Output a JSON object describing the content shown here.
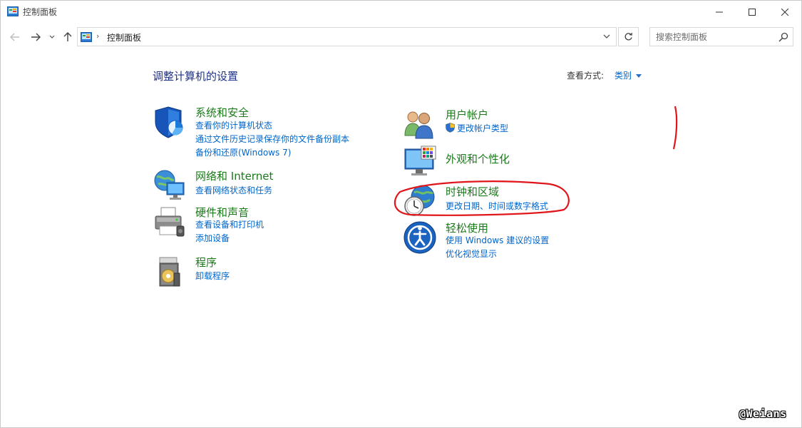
{
  "window": {
    "title": "控制面板"
  },
  "address": {
    "crumb": "控制面板"
  },
  "search": {
    "placeholder": "搜索控制面板"
  },
  "content": {
    "page_title": "调整计算机的设置",
    "view_by_label": "查看方式:",
    "view_by_value": "类别"
  },
  "categories": [
    {
      "heading": "系统和安全",
      "icon": "shield-icon",
      "links": [
        "查看你的计算机状态",
        "通过文件历史记录保存你的文件备份副本",
        "备份和还原(Windows 7)"
      ]
    },
    {
      "heading": "网络和 Internet",
      "icon": "network-globe-icon",
      "links": [
        "查看网络状态和任务"
      ]
    },
    {
      "heading": "硬件和声音",
      "icon": "printer-icon",
      "links": [
        "查看设备和打印机",
        "添加设备"
      ]
    },
    {
      "heading": "程序",
      "icon": "programs-disc-icon",
      "links": [
        "卸载程序"
      ]
    },
    {
      "heading": "用户帐户",
      "icon": "users-icon",
      "links": [
        "更改帐户类型"
      ]
    },
    {
      "heading": "外观和个性化",
      "icon": "monitor-palette-icon",
      "links": []
    },
    {
      "heading": "时钟和区域",
      "icon": "clock-globe-icon",
      "links": [
        "更改日期、时间或数字格式"
      ]
    },
    {
      "heading": "轻松使用",
      "icon": "accessibility-icon",
      "links": [
        "使用 Windows 建议的设置",
        "优化视觉显示"
      ]
    }
  ],
  "watermark": "@Weians",
  "colors": {
    "heading_green": "#1a7a1a",
    "link_blue": "#0066cc",
    "title_blue": "#1e3287",
    "annotation_red": "#e0161b"
  }
}
